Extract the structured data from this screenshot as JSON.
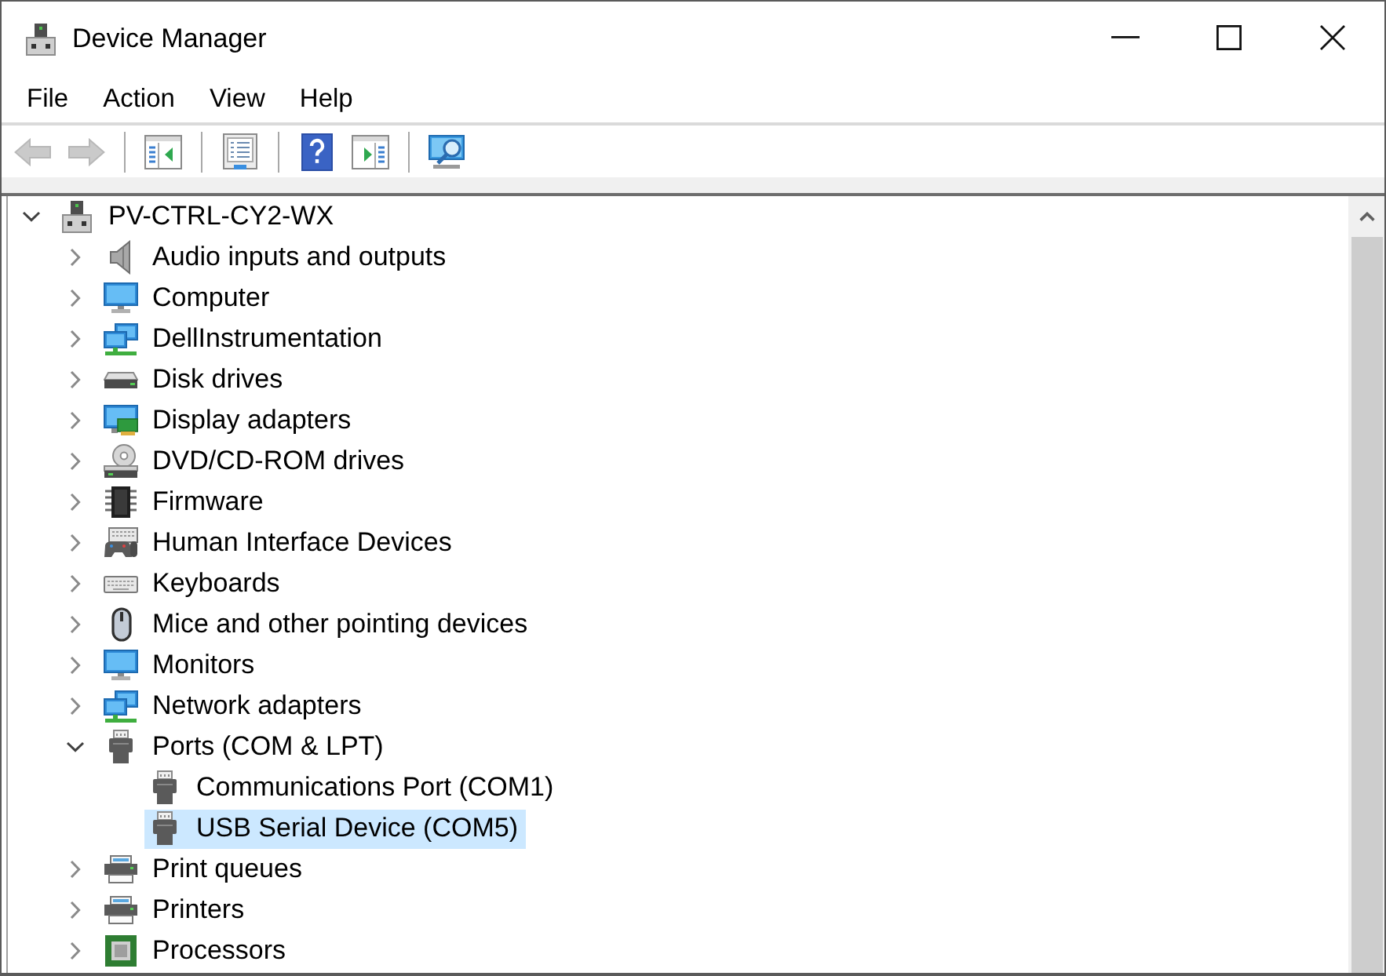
{
  "window": {
    "title": "Device Manager"
  },
  "menu": [
    {
      "label": "File"
    },
    {
      "label": "Action"
    },
    {
      "label": "View"
    },
    {
      "label": "Help"
    }
  ],
  "toolbar": {
    "groups": [
      {
        "buttons": [
          {
            "kind": "back",
            "disabled": true
          },
          {
            "kind": "forward",
            "disabled": true
          }
        ]
      },
      {
        "buttons": [
          {
            "kind": "tree-pane",
            "disabled": false
          }
        ]
      },
      {
        "buttons": [
          {
            "kind": "properties",
            "disabled": false
          }
        ]
      },
      {
        "buttons": [
          {
            "kind": "help",
            "disabled": false
          },
          {
            "kind": "action-pane",
            "disabled": false
          }
        ]
      },
      {
        "buttons": [
          {
            "kind": "scan",
            "disabled": false
          }
        ]
      }
    ]
  },
  "tree": {
    "label": "PV-CTRL-CY2-WX",
    "kind": "pc",
    "expanded": true,
    "selected": false,
    "children": [
      {
        "label": "Audio inputs and outputs",
        "kind": "audio",
        "expanded": false,
        "selected": false
      },
      {
        "label": "Computer",
        "kind": "computer",
        "expanded": false,
        "selected": false
      },
      {
        "label": "DellInstrumentation",
        "kind": "network",
        "expanded": false,
        "selected": false
      },
      {
        "label": "Disk drives",
        "kind": "disk",
        "expanded": false,
        "selected": false
      },
      {
        "label": "Display adapters",
        "kind": "display",
        "expanded": false,
        "selected": false
      },
      {
        "label": "DVD/CD-ROM drives",
        "kind": "dvd",
        "expanded": false,
        "selected": false
      },
      {
        "label": "Firmware",
        "kind": "firmware",
        "expanded": false,
        "selected": false
      },
      {
        "label": "Human Interface Devices",
        "kind": "hid",
        "expanded": false,
        "selected": false
      },
      {
        "label": "Keyboards",
        "kind": "keyboard",
        "expanded": false,
        "selected": false
      },
      {
        "label": "Mice and other pointing devices",
        "kind": "mouse",
        "expanded": false,
        "selected": false
      },
      {
        "label": "Monitors",
        "kind": "monitor",
        "expanded": false,
        "selected": false
      },
      {
        "label": "Network adapters",
        "kind": "network",
        "expanded": false,
        "selected": false
      },
      {
        "label": "Ports (COM & LPT)",
        "kind": "port",
        "expanded": true,
        "selected": false,
        "children": [
          {
            "label": "Communications Port (COM1)",
            "kind": "port",
            "selected": false
          },
          {
            "label": "USB Serial Device (COM5)",
            "kind": "port",
            "selected": true
          }
        ]
      },
      {
        "label": "Print queues",
        "kind": "printer",
        "expanded": false,
        "selected": false
      },
      {
        "label": "Printers",
        "kind": "printer",
        "expanded": false,
        "selected": false
      },
      {
        "label": "Processors",
        "kind": "processor",
        "expanded": false,
        "selected": false
      }
    ]
  }
}
